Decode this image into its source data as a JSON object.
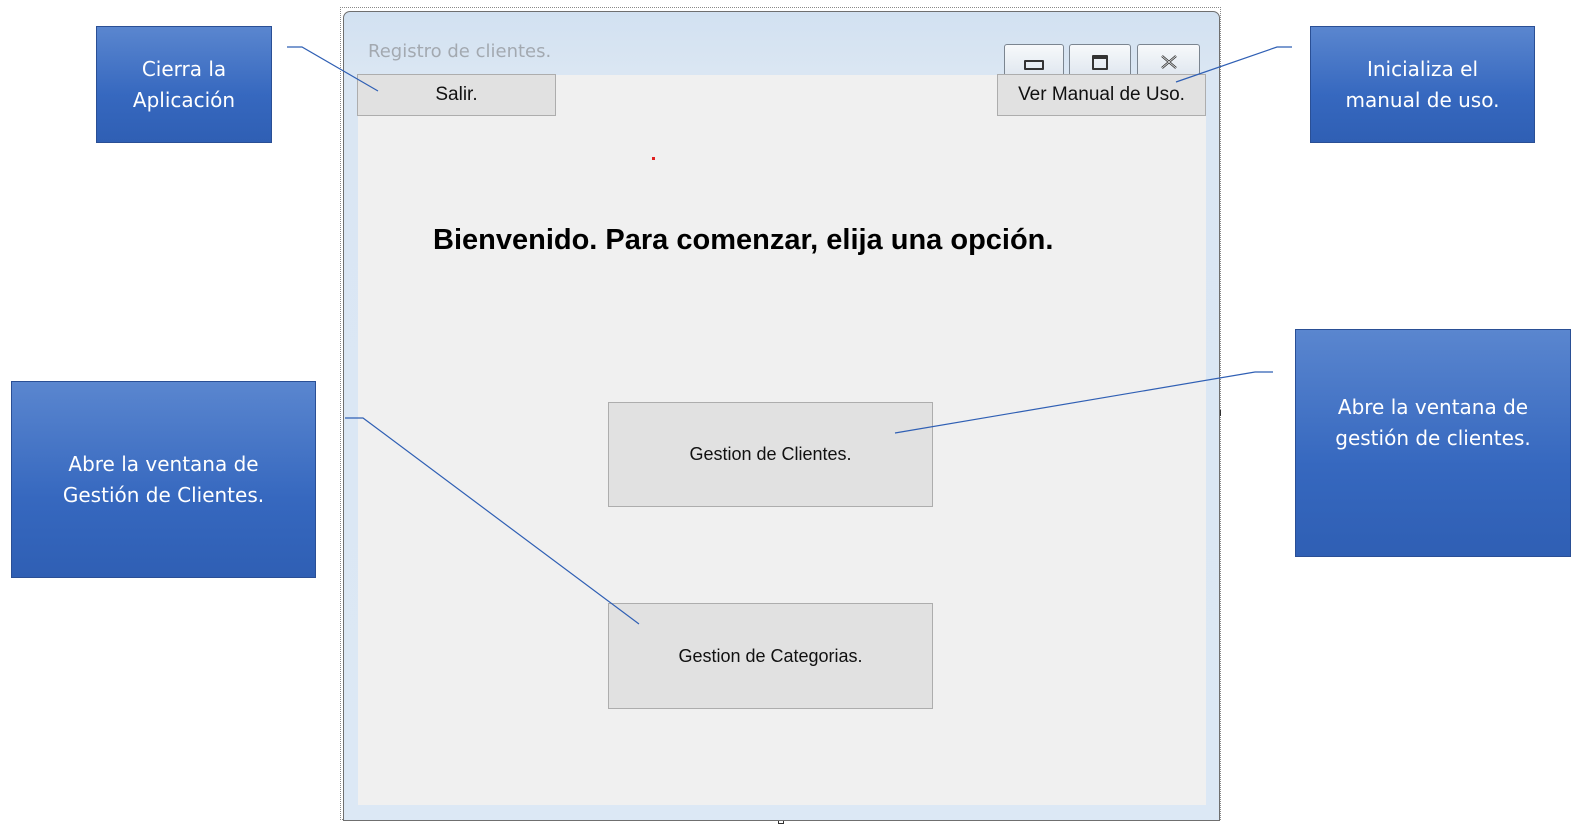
{
  "window": {
    "title": "Registro de clientes.",
    "caption_buttons": [
      "minimize-icon",
      "restore-icon",
      "close-icon"
    ]
  },
  "toolbar": {
    "exit_label": "Salir.",
    "manual_label": "Ver Manual de Uso."
  },
  "main": {
    "welcome_text": "Bienvenido. Para comenzar, elija una opción.",
    "clients_button_label": "Gestion de Clientes.",
    "categories_button_label": "Gestion de Categorias."
  },
  "annotations": {
    "exit_note": "Cierra la\nAplicación",
    "manual_note": "Inicializa el\nmanual de uso.",
    "categories_note": "Abre la ventana de\nGestión de Clientes.",
    "clients_note": "Abre la ventana de\ngestión de clientes."
  },
  "colors": {
    "callout_fill": "#3f6fc4",
    "leader_line": "#2f5fb4",
    "client_area": "#f0f0f0",
    "button_face": "#e1e1e1"
  }
}
